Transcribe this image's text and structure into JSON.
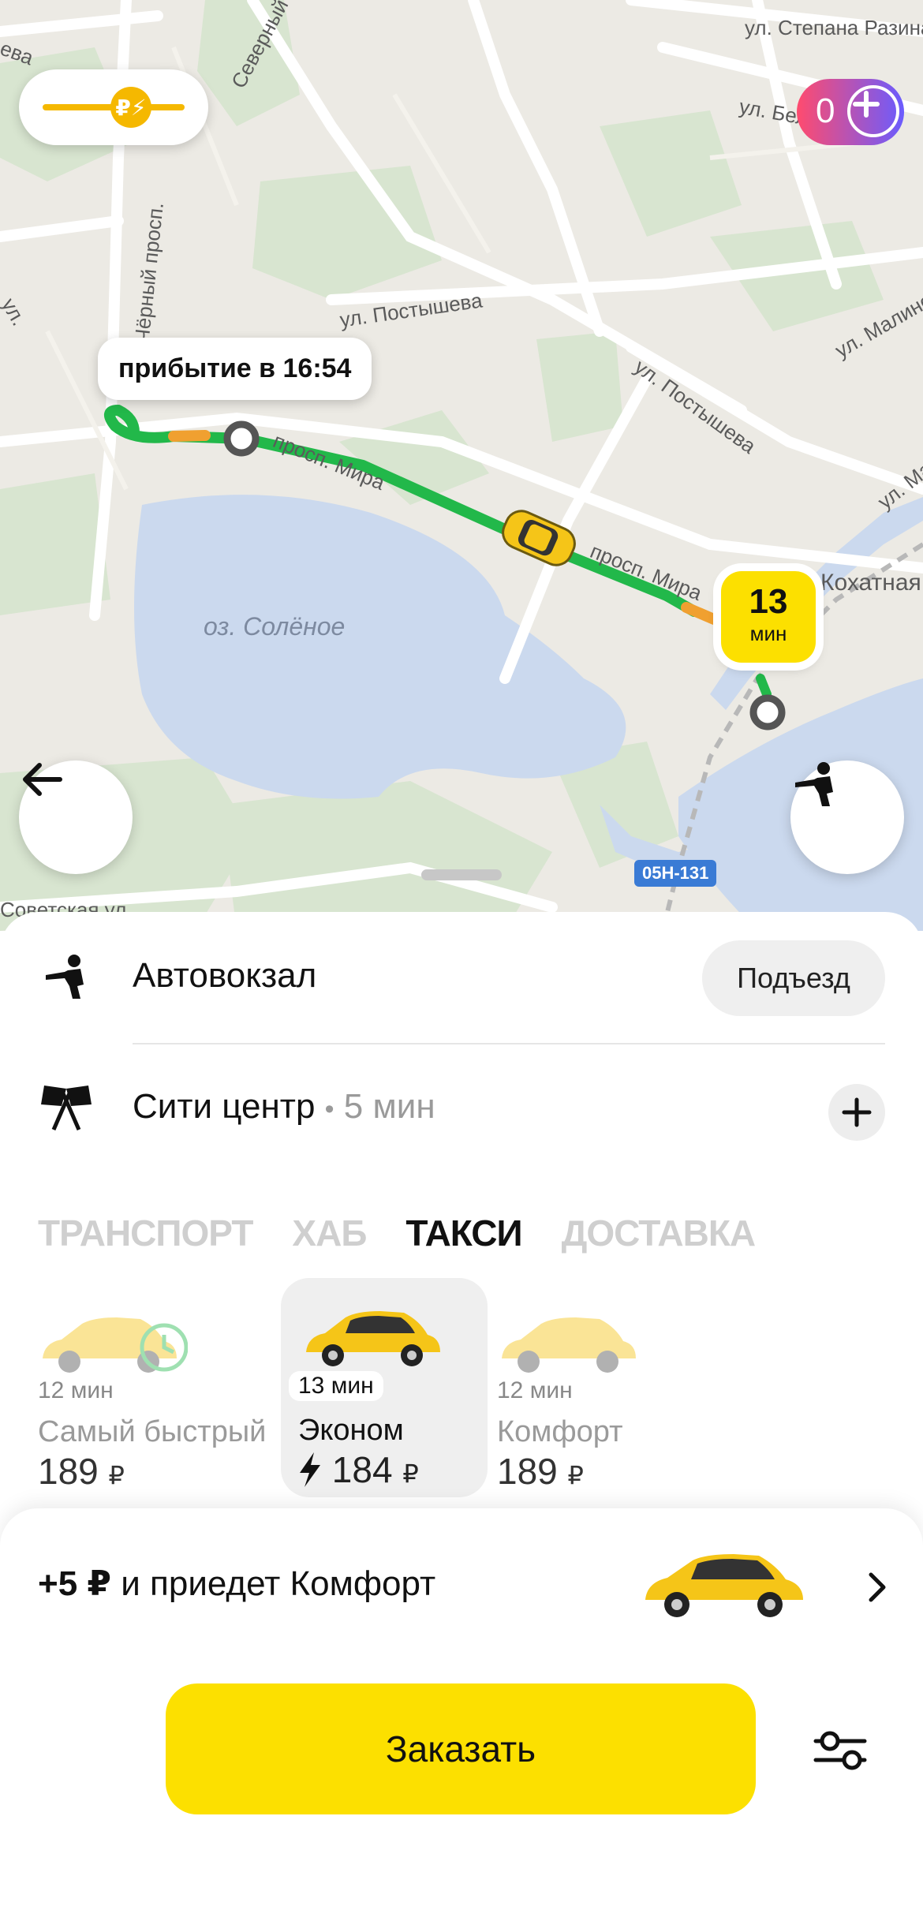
{
  "map": {
    "streets": [
      "ул. Степана Разина",
      "ул. Белинского",
      "Северный",
      "ул. Постышева",
      "ул. Постышева",
      "ул. Малинова",
      "ул. Ма",
      "просп. Мира",
      "просп. Мира",
      "Кохатная",
      "Советская ул.",
      "Чёрный просп.",
      "ева",
      "ул."
    ],
    "lake_label": "оз. Солёное",
    "road_sign": "05Н-131",
    "arrival_bubble": "прибытие в 16:54",
    "eta_value": "13",
    "eta_unit": "мин",
    "plus_points": "0"
  },
  "route": {
    "from": "Автовокзал",
    "entrance_button": "Подъезд",
    "to": "Сити центр",
    "to_separator": "•",
    "to_duration": "5 мин"
  },
  "tabs": [
    {
      "label": "ТРАНСПОРТ",
      "active": false
    },
    {
      "label": "ХАБ",
      "active": false
    },
    {
      "label": "ТАКСИ",
      "active": true
    },
    {
      "label": "ДОСТАВКА",
      "active": false
    }
  ],
  "tariffs": [
    {
      "time": "12 мин",
      "name": "Самый быстрый",
      "price": "189",
      "currency": "₽"
    },
    {
      "time": "13 мин",
      "name": "Эконом",
      "price": "184",
      "currency": "₽",
      "selected": true
    },
    {
      "time": "12 мин",
      "name": "Комфорт",
      "price": "189",
      "currency": "₽"
    }
  ],
  "upsell": {
    "amount": "+5 ₽",
    "text": " и приедет Комфорт"
  },
  "order_button": "Заказать",
  "colors": {
    "accent_yellow": "#fce000",
    "route_green": "#22b84a",
    "plus_gradient_start": "#ff4b6e",
    "plus_gradient_end": "#6a5cff",
    "map_background": "#eceae4",
    "water": "#cbd9ee"
  }
}
